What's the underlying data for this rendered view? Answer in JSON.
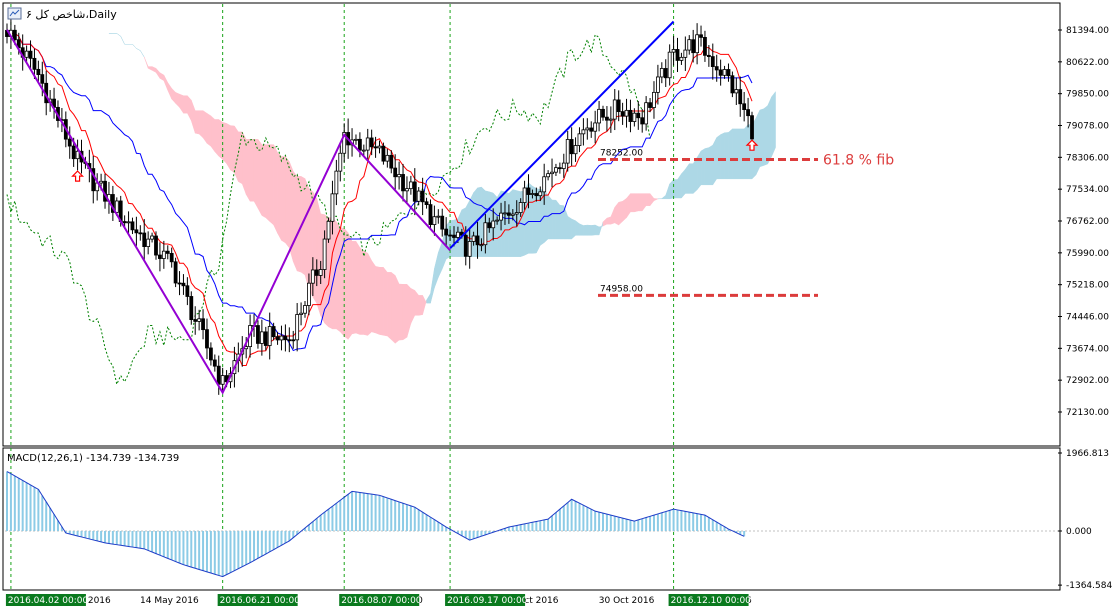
{
  "window": {
    "title": "شاخص کل ۶،Daily",
    "icon": "chart-window-icon"
  },
  "colors": {
    "background": "#ffffff",
    "grid": "#19a319",
    "axis": "#000000",
    "cloud_bull": "#add8e6",
    "cloud_bear": "#ffc0cb",
    "tenkan": "#ff0000",
    "kijun": "#0000ff",
    "chikou": "#008000",
    "zigzag": "#9400d3",
    "trend": "#0000ff",
    "fib": "#dc3c3c",
    "macd": "#8ccbe6",
    "signal": "#1e3cc8",
    "arrow": "#ff0000"
  },
  "chart_data": [
    {
      "type": "candlestick",
      "name": "price",
      "ylim": [
        71300,
        82100
      ],
      "y_ticks": [
        "81394.00",
        "80622.00",
        "79850.00",
        "79078.00",
        "78306.00",
        "77534.00",
        "76762.00",
        "75990.00",
        "75218.00",
        "74446.00",
        "73674.00",
        "72902.00",
        "72130.00"
      ],
      "x_labels": [
        "Apr 2016",
        "14 May 2016",
        "2016",
        "Aug 20",
        "4 Oct 2016",
        "30 Oct 2016",
        "Dec 2016"
      ],
      "date_markers": [
        "2016.04.02 00:00",
        "2016.06.21 00:00",
        "2016.08.07 00:00",
        "2016.09.17 00:00",
        "2016.12.10 00:00"
      ],
      "price_points": [
        {
          "i": 0,
          "v": 81400
        },
        {
          "i": 8,
          "v": 80300
        },
        {
          "i": 18,
          "v": 78200
        },
        {
          "i": 30,
          "v": 76800
        },
        {
          "i": 42,
          "v": 75700
        },
        {
          "i": 55,
          "v": 72800
        },
        {
          "i": 62,
          "v": 74000
        },
        {
          "i": 72,
          "v": 73900
        },
        {
          "i": 80,
          "v": 75800
        },
        {
          "i": 86,
          "v": 78850
        },
        {
          "i": 95,
          "v": 78400
        },
        {
          "i": 104,
          "v": 77400
        },
        {
          "i": 112,
          "v": 76400
        },
        {
          "i": 118,
          "v": 76100
        },
        {
          "i": 128,
          "v": 77000
        },
        {
          "i": 138,
          "v": 77900
        },
        {
          "i": 148,
          "v": 79100
        },
        {
          "i": 156,
          "v": 79500
        },
        {
          "i": 162,
          "v": 79300
        },
        {
          "i": 170,
          "v": 80800
        },
        {
          "i": 176,
          "v": 81100
        },
        {
          "i": 184,
          "v": 80200
        },
        {
          "i": 190,
          "v": 79000
        }
      ],
      "zigzag": [
        {
          "i": 0,
          "v": 81400
        },
        {
          "i": 55,
          "v": 72600
        },
        {
          "i": 86,
          "v": 78850
        },
        {
          "i": 113,
          "v": 76050
        }
      ],
      "trend_line": [
        {
          "i": 113,
          "v": 76100
        },
        {
          "i": 170,
          "v": 81600
        }
      ],
      "fib_levels": [
        {
          "price": "78252.00",
          "label": "61.8 % fib",
          "v": 78252
        },
        {
          "price": "74958.00",
          "label": "",
          "v": 74958
        }
      ],
      "arrows": [
        {
          "i": 18,
          "v": 77850
        },
        {
          "i": 190,
          "v": 78600
        }
      ]
    },
    {
      "type": "histogram",
      "name": "macd",
      "label": "MACD(12,26,1) -134.739 -134.739",
      "ylim": [
        -1364.584,
        1966.813
      ],
      "y_ticks": [
        "1966.813",
        "0.000",
        "-1364.584"
      ],
      "points": [
        {
          "i": 0,
          "v": 1500
        },
        {
          "i": 8,
          "v": 1050
        },
        {
          "i": 15,
          "v": -50
        },
        {
          "i": 25,
          "v": -300
        },
        {
          "i": 35,
          "v": -450
        },
        {
          "i": 45,
          "v": -850
        },
        {
          "i": 55,
          "v": -1150
        },
        {
          "i": 62,
          "v": -800
        },
        {
          "i": 72,
          "v": -250
        },
        {
          "i": 80,
          "v": 400
        },
        {
          "i": 88,
          "v": 1000
        },
        {
          "i": 95,
          "v": 900
        },
        {
          "i": 104,
          "v": 600
        },
        {
          "i": 112,
          "v": 100
        },
        {
          "i": 118,
          "v": -230
        },
        {
          "i": 128,
          "v": 100
        },
        {
          "i": 138,
          "v": 300
        },
        {
          "i": 144,
          "v": 800
        },
        {
          "i": 150,
          "v": 500
        },
        {
          "i": 160,
          "v": 250
        },
        {
          "i": 170,
          "v": 550
        },
        {
          "i": 178,
          "v": 400
        },
        {
          "i": 184,
          "v": 50
        },
        {
          "i": 188,
          "v": -135
        }
      ]
    }
  ]
}
